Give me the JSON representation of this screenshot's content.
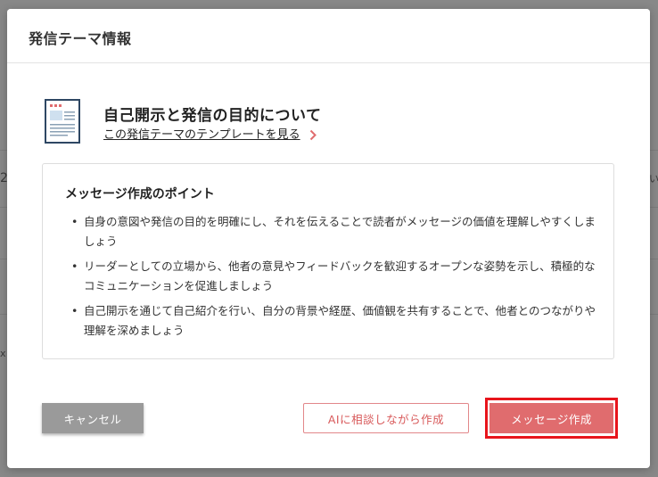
{
  "background": {
    "fragments": [
      "2",
      "い",
      "x"
    ]
  },
  "modal": {
    "title": "発信テーマ情報",
    "theme_heading": "自己開示と発信の目的について",
    "template_link": "この発信テーマのテンプレートを見る",
    "points": {
      "title": "メッセージ作成のポイント",
      "items": [
        "自身の意図や発信の目的を明確にし、それを伝えることで読者がメッセージの価値を理解しやすくしましょう",
        "リーダーとしての立場から、他者の意見やフィードバックを歓迎するオープンな姿勢を示し、積極的なコミュニケーションを促進しましょう",
        "自己開示を通じて自己紹介を行い、自分の背景や経歴、価値観を共有することで、他者とのつながりや理解を深めましょう"
      ]
    },
    "buttons": {
      "cancel": "キャンセル",
      "ai_create": "AIに相談しながら作成",
      "create_message": "メッセージ作成"
    }
  },
  "colors": {
    "accent": "#e06c6e",
    "highlight": "#e8151c",
    "cancel_bg": "#9a9a9a"
  },
  "icons": {
    "document": "document-icon",
    "chevron": "chevron-right-icon"
  }
}
